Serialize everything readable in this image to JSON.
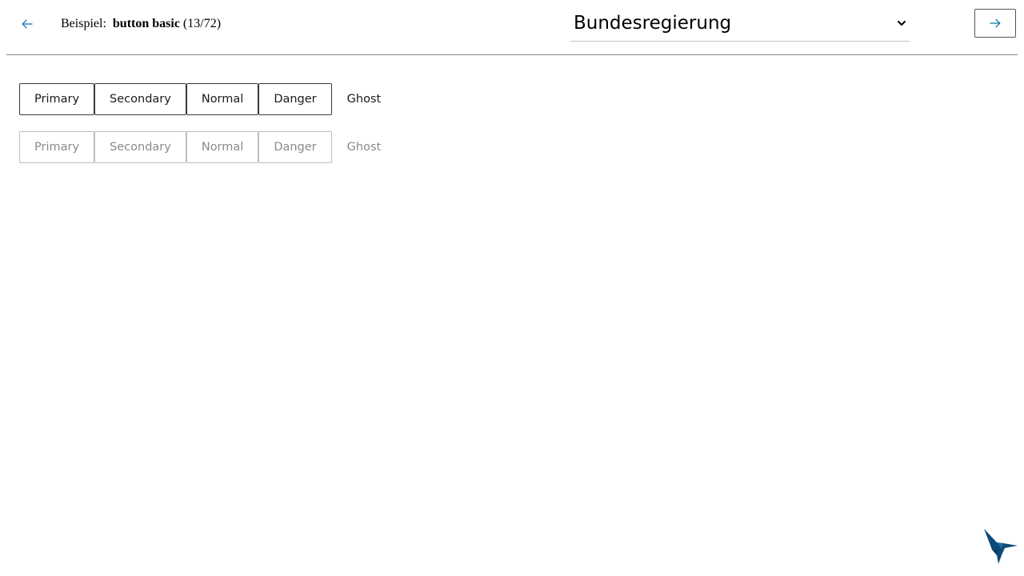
{
  "header": {
    "prev_icon": "arrow-left-icon",
    "example_prefix": "Beispiel:",
    "example_name": "button basic",
    "example_counter": "(13/72)",
    "theme_select": {
      "selected": "Bundesregierung",
      "icon": "chevron-down-icon"
    },
    "next_icon": "arrow-right-icon"
  },
  "rows": {
    "enabled": {
      "buttons": [
        "Primary",
        "Secondary",
        "Normal",
        "Danger",
        "Ghost"
      ]
    },
    "disabled": {
      "buttons": [
        "Primary",
        "Secondary",
        "Normal",
        "Danger",
        "Ghost"
      ]
    }
  },
  "footer": {
    "logo_icon": "hummingbird-logo-icon"
  },
  "colors": {
    "accent": "#0b6fa8",
    "border": "#3a3a3a",
    "disabled_border": "#bdbdbd",
    "disabled_text": "#8a8a8a",
    "divider": "#8a8a8a",
    "logo": "#0d4a78"
  }
}
